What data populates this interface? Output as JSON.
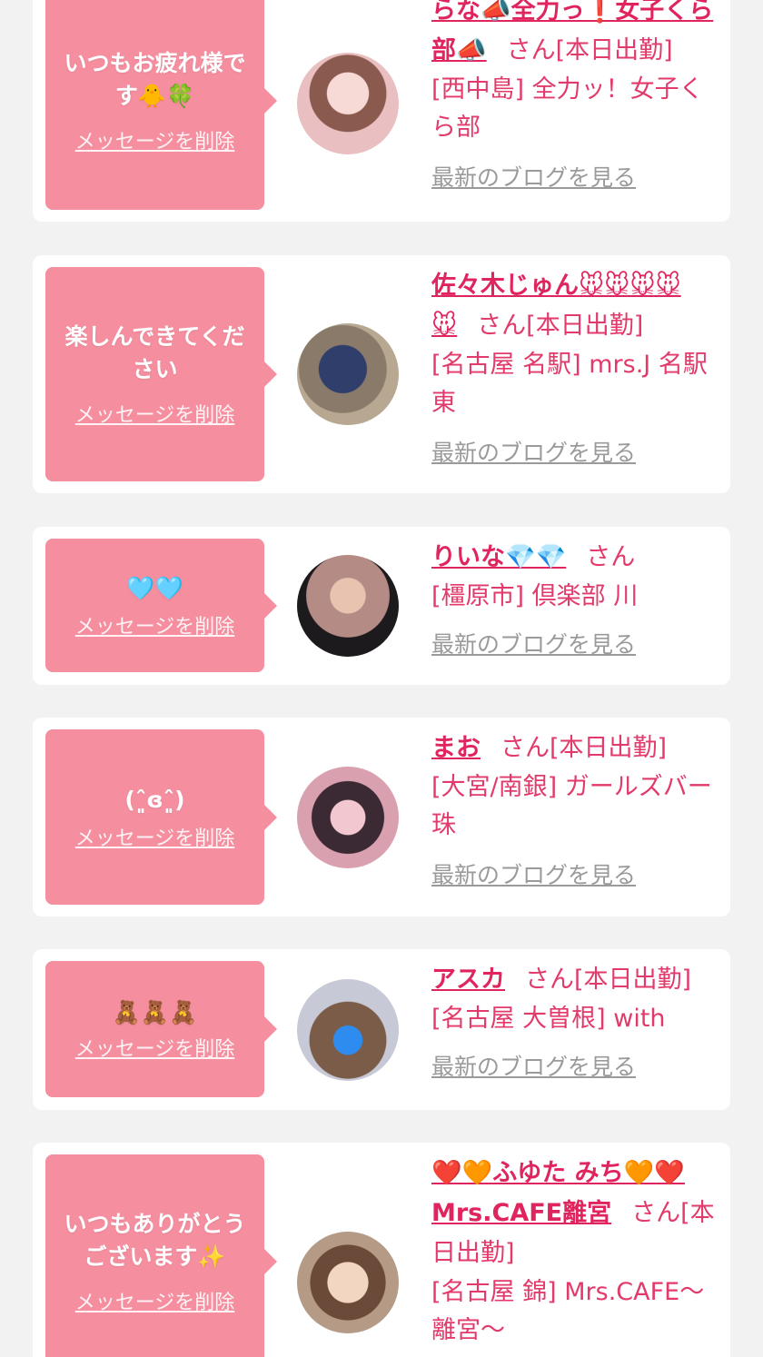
{
  "cards": [
    {
      "message": "いつもお疲れ様です🐥🍀",
      "delete_label": "メッセージを削除",
      "name": "らな📣全力っ❗女子くら部📣",
      "suffix": "さん[本日出勤]",
      "shop": "[西中島] 全力ッ！女子くら部",
      "blog_label": "最新のブログを見る"
    },
    {
      "message": "楽しんできてください",
      "delete_label": "メッセージを削除",
      "name": "佐々木じゅん🐭🐭🐭🐭🐭",
      "suffix": "さん[本日出勤]",
      "shop": "[名古屋 名駅] mrs.J 名駅東",
      "blog_label": "最新のブログを見る"
    },
    {
      "message": "🩵🩵",
      "delete_label": "メッセージを削除",
      "name": "りいな💎💎",
      "suffix": "さん",
      "shop": "[橿原市] 倶楽部 川",
      "blog_label": "最新のブログを見る"
    },
    {
      "message": "(ˆ͈ɞˆ͈)",
      "delete_label": "メッセージを削除",
      "name": "まお",
      "suffix": "さん[本日出勤]",
      "shop": "[大宮/南銀] ガールズバー 珠",
      "blog_label": "最新のブログを見る"
    },
    {
      "message": "🧸🧸🧸",
      "delete_label": "メッセージを削除",
      "name": "アスカ",
      "suffix": "さん[本日出勤]",
      "shop": "[名古屋 大曽根] with",
      "blog_label": "最新のブログを見る"
    },
    {
      "message": "いつもありがとうございます✨",
      "delete_label": "メッセージを削除",
      "name": "❤️🧡ふゆた みち🧡❤️Mrs.CAFE離宮",
      "suffix": "さん[本日出勤]",
      "shop": "[名古屋 錦] Mrs.CAFE〜離宮〜",
      "blog_label": ""
    }
  ],
  "colors": {
    "bubble": "#f58fa0",
    "name": "#e0245e",
    "text": "#e23a6a",
    "link_gray": "#9a9a9a",
    "background": "#f2f2f2"
  }
}
